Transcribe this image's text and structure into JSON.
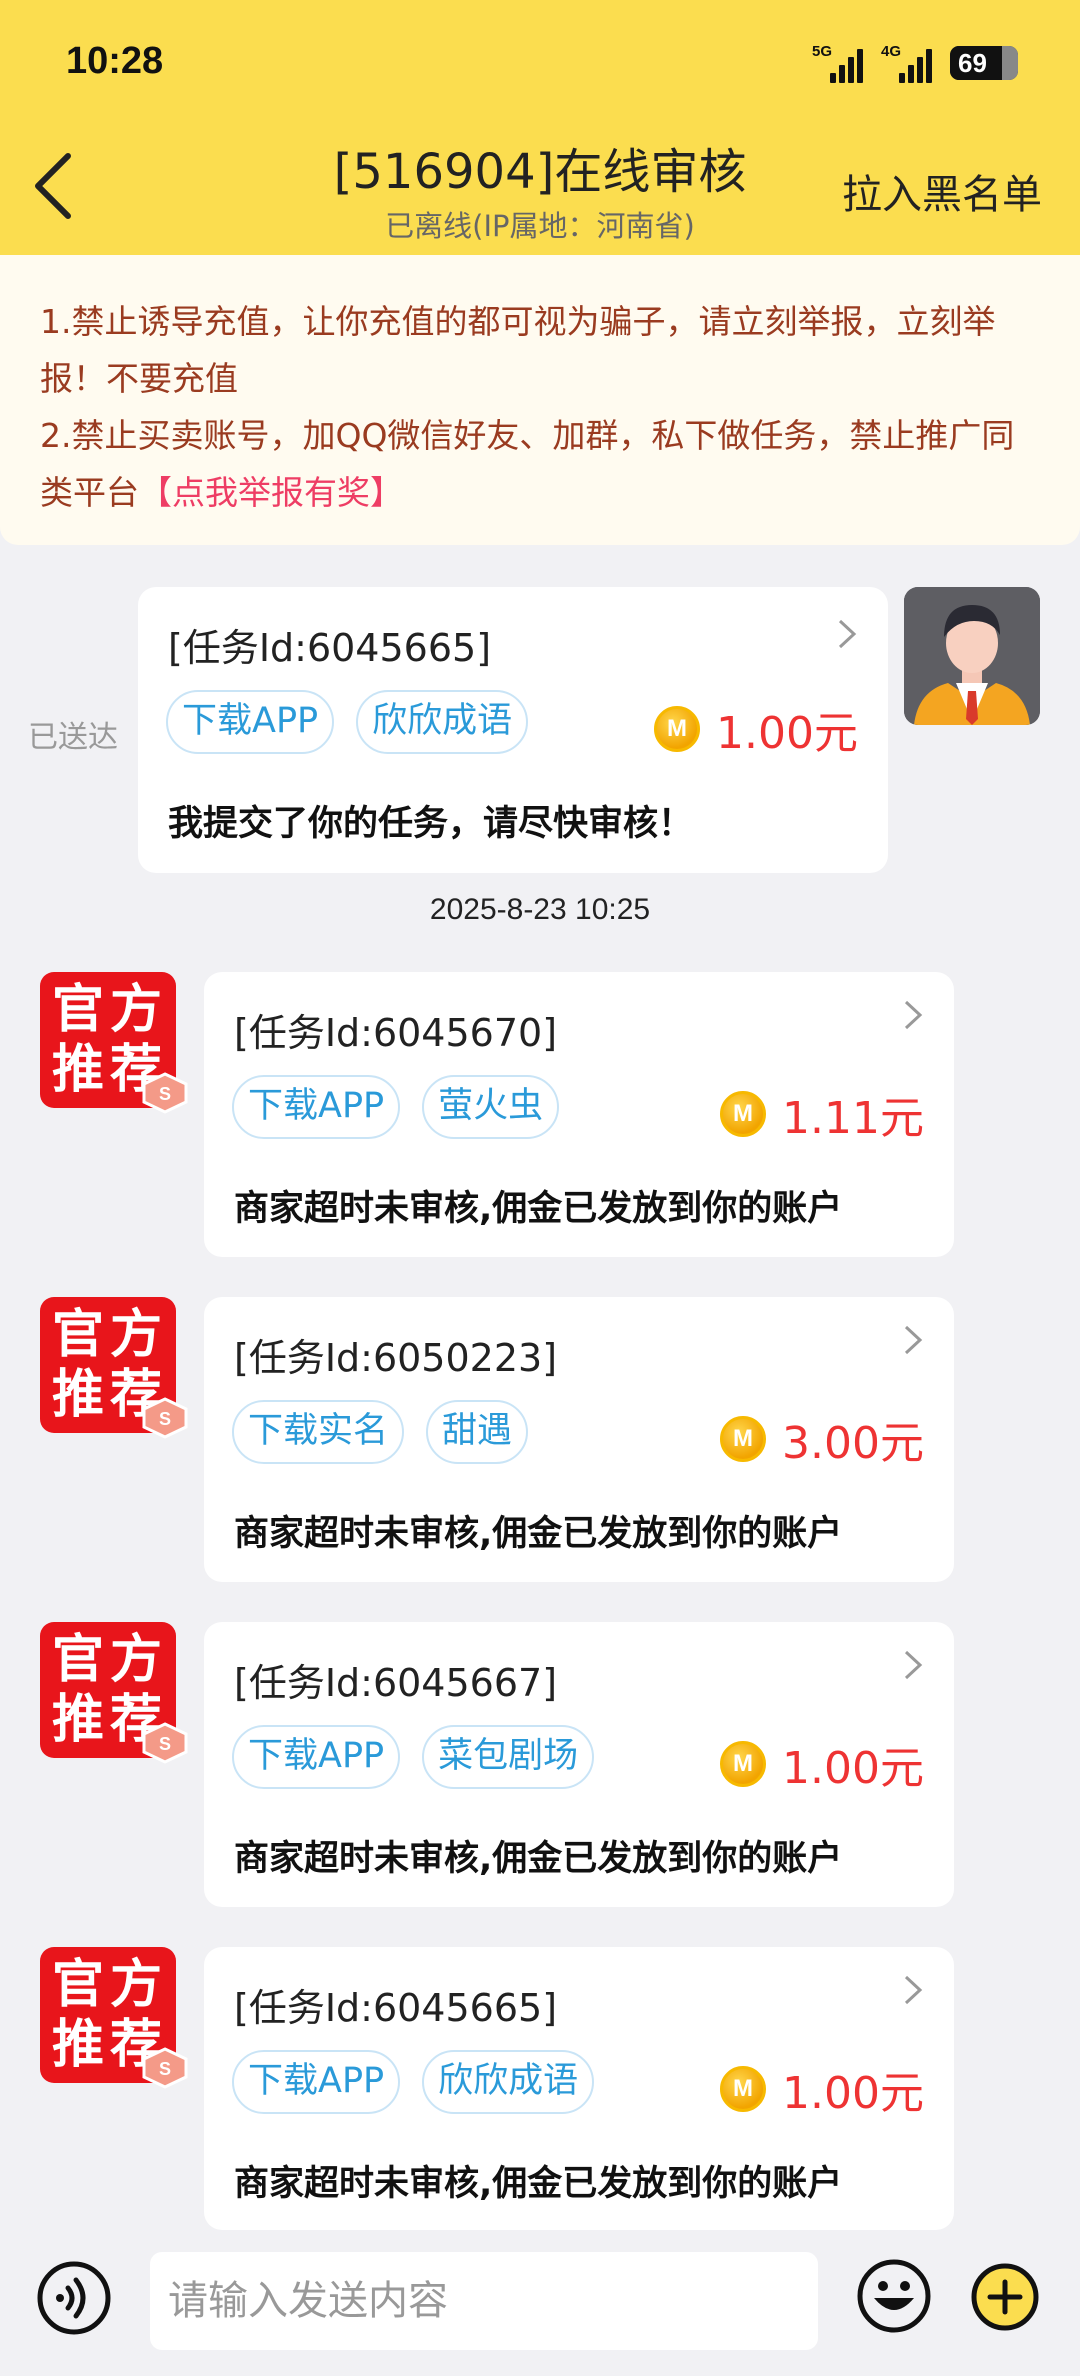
{
  "status_bar": {
    "time": "10:28",
    "network_1": "5G",
    "network_2": "4G",
    "battery": "69"
  },
  "header": {
    "title": "[516904]在线审核",
    "subtitle": "已离线(IP属地：河南省)",
    "blacklist_label": "拉入黑名单",
    "background_color": "#fbdd4f"
  },
  "notice": {
    "line1": "1.禁止诱导充值，让你充值的都可视为骗子，请立刻举报，立刻举报！不要充值",
    "line2": "2.禁止买卖账号，加QQ微信好友、加群，私下做任务，禁止推广同类平台",
    "link": "【点我举报有奖】"
  },
  "chat": {
    "sent_status": "已送达",
    "my_message": {
      "task_id": "[任务Id:6045665]",
      "tags": [
        "下载APP",
        "欣欣成语"
      ],
      "coin": "M",
      "amount": "1.00元",
      "text": "我提交了你的任务，请尽快审核！"
    },
    "timestamp": "2025-8-23 10:25",
    "official_badge_line1": "官方",
    "official_badge_line2": "推荐",
    "replies": [
      {
        "task_id": "[任务Id:6045670]",
        "tags": [
          "下载APP",
          "萤火虫"
        ],
        "amount": "1.11元",
        "text": "商家超时未审核,佣金已发放到你的账户"
      },
      {
        "task_id": "[任务Id:6050223]",
        "tags": [
          "下载实名",
          "甜遇"
        ],
        "amount": "3.00元",
        "text": "商家超时未审核,佣金已发放到你的账户"
      },
      {
        "task_id": "[任务Id:6045667]",
        "tags": [
          "下载APP",
          "菜包剧场"
        ],
        "amount": "1.00元",
        "text": "商家超时未审核,佣金已发放到你的账户"
      },
      {
        "task_id": "[任务Id:6045665]",
        "tags": [
          "下载APP",
          "欣欣成语"
        ],
        "amount": "1.00元",
        "text": "商家超时未审核,佣金已发放到你的账户"
      }
    ]
  },
  "input": {
    "placeholder": "请输入发送内容"
  },
  "colors": {
    "accent_yellow": "#fbdd4f",
    "price_red": "#ee3333",
    "tag_blue": "#2a9ad9",
    "badge_red": "#e8151b",
    "notice_text": "#9a3b20",
    "notice_link": "#ee3d64"
  }
}
